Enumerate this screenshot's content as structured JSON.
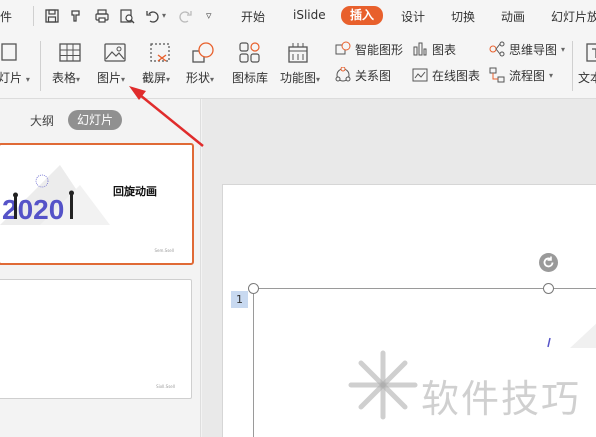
{
  "menubar": {
    "partial_left": "件",
    "quick_access": [
      "save-icon",
      "format-painter-icon",
      "print-icon",
      "print-preview-icon",
      "undo-icon",
      "redo-icon",
      "more-dropdown-icon"
    ],
    "tabs": [
      "开始",
      "iSlide",
      "插入",
      "设计",
      "切换",
      "动画",
      "幻灯片放"
    ],
    "active_tab": "插入"
  },
  "ribbon": {
    "new_slide_partial": "灯片",
    "table": "表格",
    "picture": "图片",
    "screenshot": "截屏",
    "shape": "形状",
    "icon_library": "图标库",
    "function_chart": "功能图",
    "smart_shape": "智能图形",
    "chart": "图表",
    "mindmap": "思维导图",
    "relation_chart": "关系图",
    "online_chart": "在线图表",
    "flowchart": "流程图",
    "textbox_partial": "文本"
  },
  "leftpanel": {
    "tab_outline": "大纲",
    "tab_slides": "幻灯片",
    "slide1_title": "回旋动画",
    "slide1_year": "2020",
    "slide1_footer": "Sem.Ssell",
    "slide2_footer": "Sixll.Ssell"
  },
  "canvas": {
    "slide_number": "1",
    "watermark_text": "软件技巧"
  },
  "colors": {
    "accent": "#e8602c",
    "slides_tab": "#909090",
    "arrow": "#e02c2c",
    "slide_number_bg": "#c8d9f0"
  }
}
